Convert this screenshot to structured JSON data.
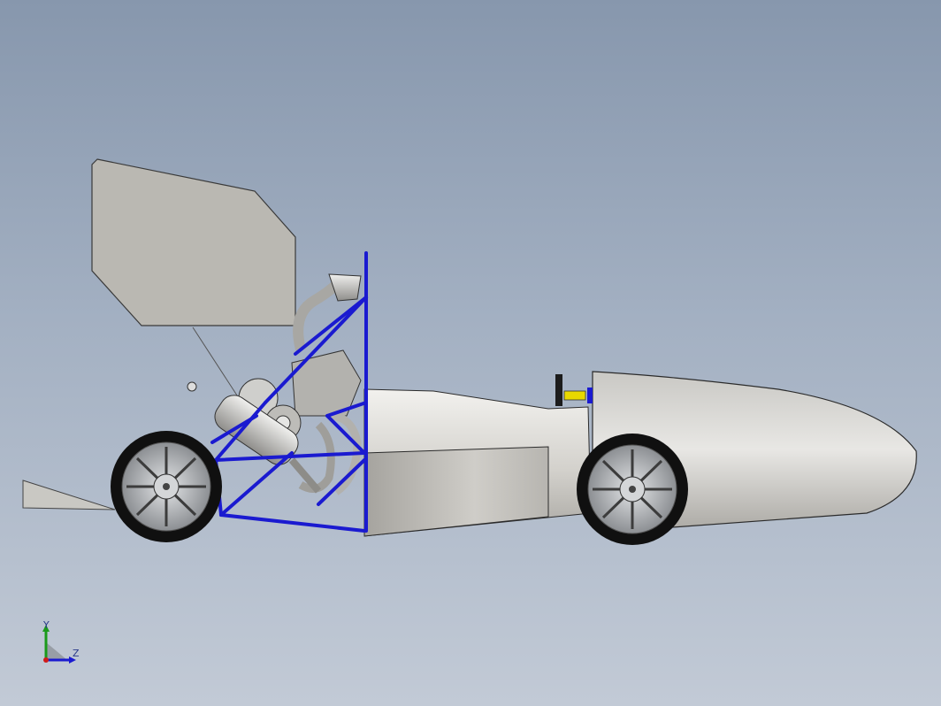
{
  "viewport": {
    "model": "formula-student-car-side-view",
    "colors": {
      "background_top": "#8797ad",
      "background_bottom": "#c2cad6",
      "frame": "#1a1ad0",
      "body": "#d6d4cf",
      "wing": "#b8b6b0",
      "tire": "#101010",
      "rim": "#b9bcc0"
    }
  },
  "triad": {
    "y_label": "Y",
    "z_label": "Z",
    "icons": [
      "view-orientation-triad-icon"
    ]
  }
}
